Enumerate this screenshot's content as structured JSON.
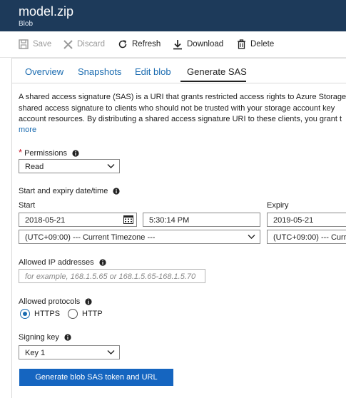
{
  "header": {
    "title": "model.zip",
    "subtitle": "Blob"
  },
  "toolbar": {
    "save": "Save",
    "discard": "Discard",
    "refresh": "Refresh",
    "download": "Download",
    "delete": "Delete"
  },
  "tabs": [
    {
      "label": "Overview"
    },
    {
      "label": "Snapshots"
    },
    {
      "label": "Edit blob"
    },
    {
      "label": "Generate SAS"
    }
  ],
  "description": {
    "lines": [
      "A shared access signature (SAS) is a URI that grants restricted access rights to Azure Storage",
      "shared access signature to clients who should not be trusted with your storage account key",
      "account resources. By distributing a shared access signature URI to these clients, you grant t"
    ],
    "more": "more"
  },
  "permissions": {
    "label": "Permissions",
    "required_mark": "*",
    "value": "Read"
  },
  "dates": {
    "section_label": "Start and expiry date/time",
    "start_label": "Start",
    "start_date": "2018-05-21",
    "start_time": "5:30:14 PM",
    "timezone": "(UTC+09:00) --- Current Timezone ---",
    "expiry_label": "Expiry",
    "expiry_date": "2019-05-21",
    "expiry_timezone": "(UTC+09:00) --- Curr"
  },
  "ip": {
    "label": "Allowed IP addresses",
    "placeholder": "for example, 168.1.5.65 or 168.1.5.65-168.1.5.70"
  },
  "protocols": {
    "label": "Allowed protocols",
    "options": [
      {
        "label": "HTTPS",
        "checked": true
      },
      {
        "label": "HTTP",
        "checked": false
      }
    ]
  },
  "signing": {
    "label": "Signing key",
    "value": "Key 1"
  },
  "generate_button": "Generate blob SAS token and URL",
  "colors": {
    "header_bg": "#1d3a5a",
    "accent": "#1565c0",
    "link": "#1a6bb0"
  }
}
